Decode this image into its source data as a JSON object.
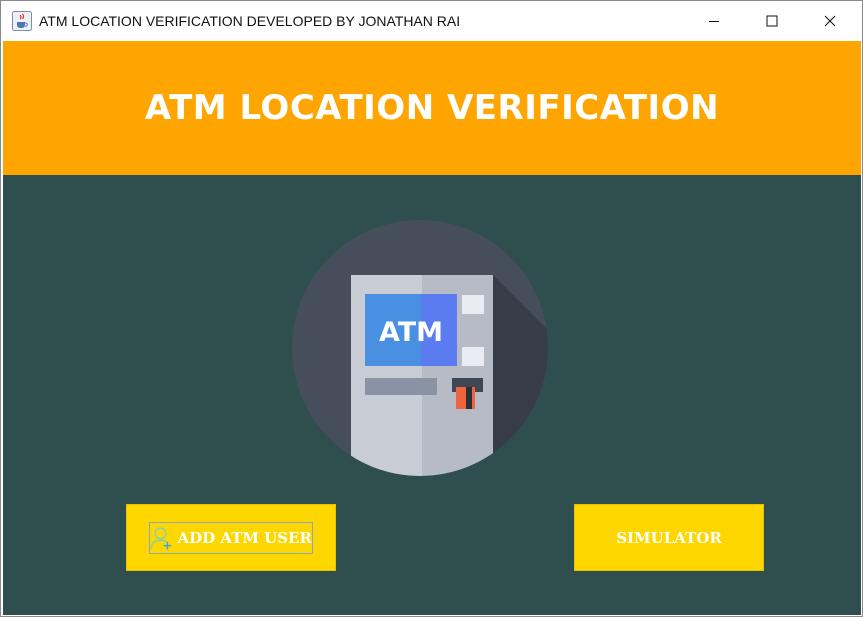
{
  "window": {
    "title": "ATM LOCATION VERIFICATION DEVELOPED BY JONATHAN RAI",
    "icon": "java-coffee-cup-icon"
  },
  "header": {
    "title": "ATM LOCATION VERIFICATION",
    "background": "#fea501"
  },
  "main": {
    "background": "#2f4f4f",
    "illustration": {
      "screen_text": "ATM"
    },
    "buttons": {
      "add_atm_user": "ADD ATM USER",
      "simulator": "SIMULATOR"
    },
    "button_color": "#ffd700"
  }
}
